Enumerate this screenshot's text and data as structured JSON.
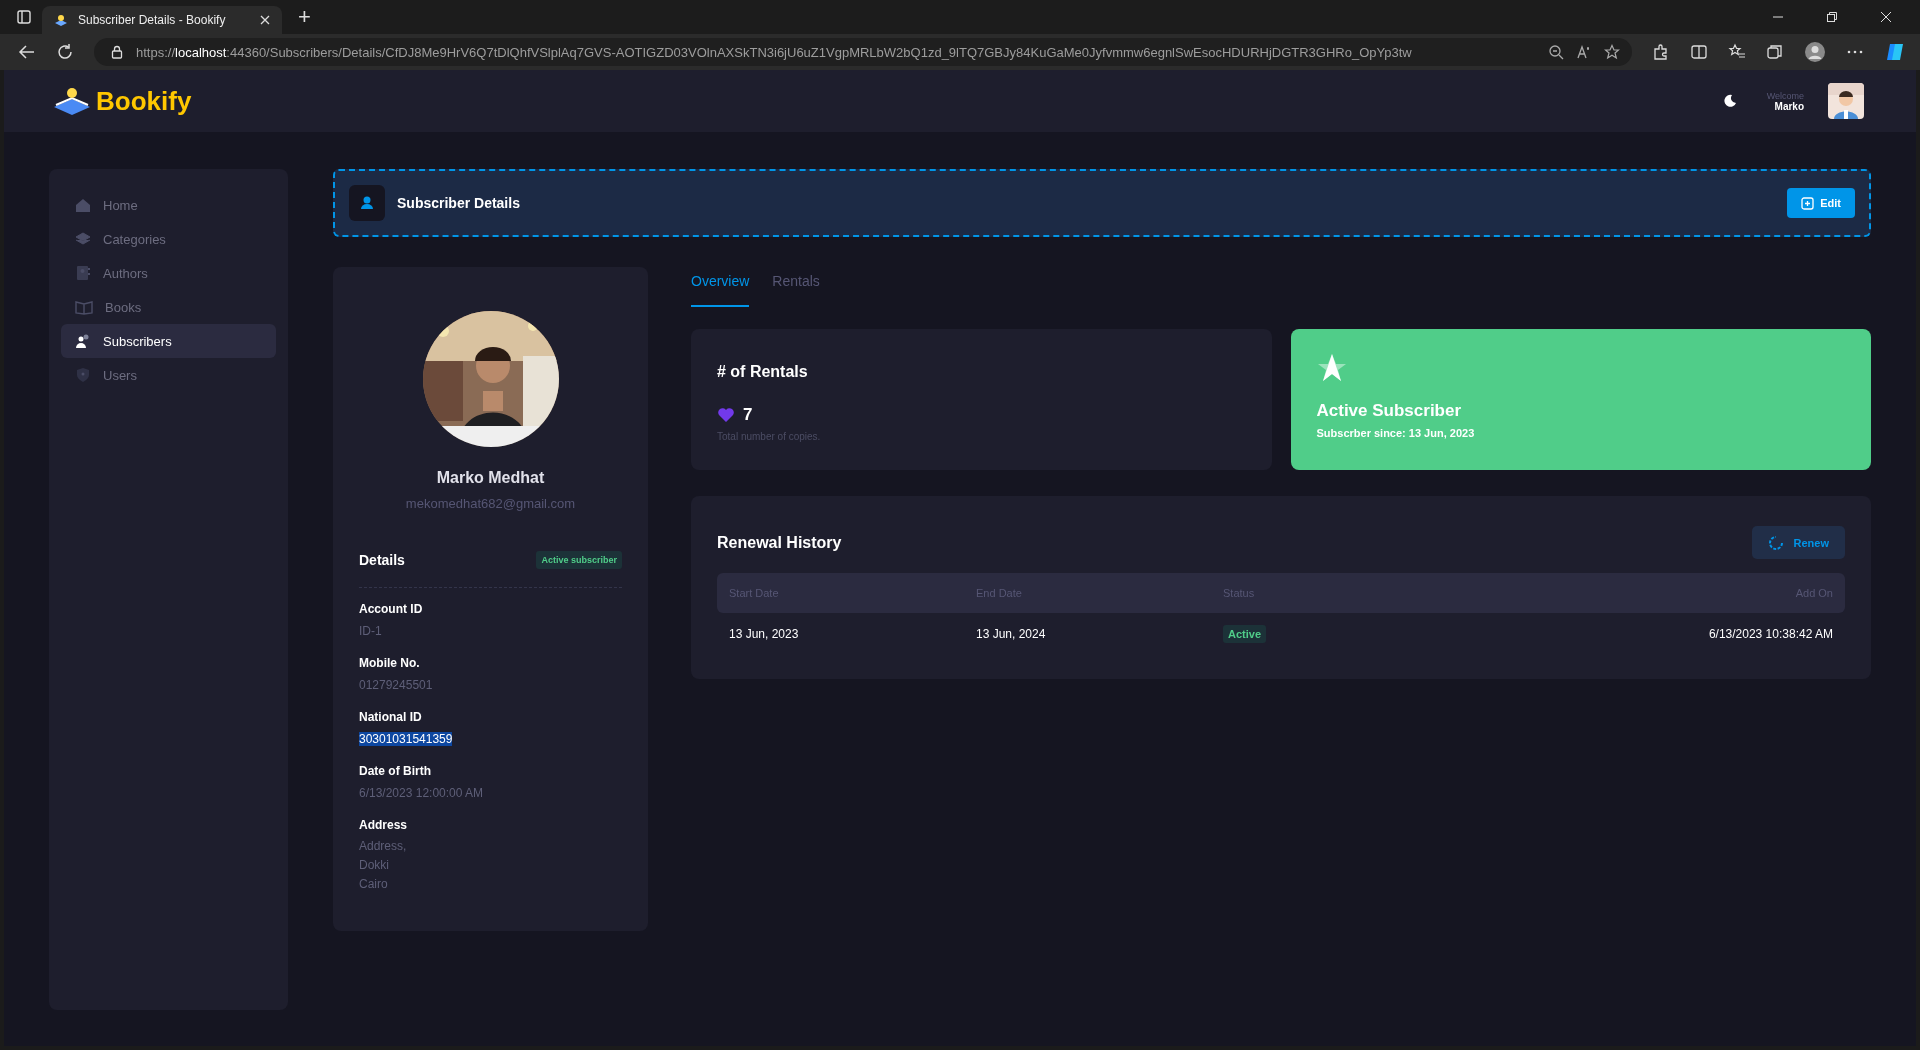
{
  "browser": {
    "tab_title": "Subscriber Details - Bookify",
    "new_tab": "+",
    "url": "https://**localhost**:44360/Subscribers/Details/CfDJ8Me9HrV6Q7tDlQhfVSlplAq7GVS-AOTIGZD03VOlnAXSkTN3i6jU6uZ1VgpMRLbW2bQ1zd_9lTQ7GBJy84KuGaMe0Jyfvmmw6egnlSwEsocHDURHjDGTR3GHRo_OpYp3tw"
  },
  "header": {
    "logo": "Bookify",
    "welcome": "Welcome",
    "user": "Marko"
  },
  "sidebar": {
    "items": [
      {
        "label": "Home",
        "kind": "home",
        "selected": false
      },
      {
        "label": "Categories",
        "kind": "layers",
        "selected": false
      },
      {
        "label": "Authors",
        "kind": "contacts",
        "selected": false
      },
      {
        "label": "Books",
        "kind": "book",
        "selected": false
      },
      {
        "label": "Subscribers",
        "kind": "people",
        "selected": true
      },
      {
        "label": "Users",
        "kind": "shield",
        "selected": false
      }
    ]
  },
  "page_title": "Subscriber Details",
  "edit_button": "Edit",
  "profile": {
    "name": "Marko Medhat",
    "email": "mekomedhat682@gmail.com",
    "details_title": "Details",
    "badge": "Active subscriber",
    "fields": [
      {
        "label": "Account ID",
        "lines": [
          "ID-1"
        ],
        "highlighted": false
      },
      {
        "label": "Mobile No.",
        "lines": [
          "01279245501"
        ],
        "highlighted": false
      },
      {
        "label": "National ID",
        "lines": [
          "30301031541359"
        ],
        "highlighted": true
      },
      {
        "label": "Date of Birth",
        "lines": [
          "6/13/2023 12:00:00 AM"
        ],
        "highlighted": false
      },
      {
        "label": "Address",
        "lines": [
          "Address,",
          "Dokki",
          "Cairo"
        ],
        "highlighted": false
      }
    ]
  },
  "tabs": [
    {
      "label": "Overview",
      "selected": true
    },
    {
      "label": "Rentals",
      "selected": false
    }
  ],
  "rentals_card": {
    "title": "# of Rentals",
    "count": "7",
    "note": "Total number of copies."
  },
  "status_card": {
    "title": "Active Subscriber",
    "since": "Subscrber since: 13 Jun, 2023"
  },
  "renewal": {
    "title": "Renewal History",
    "button": "Renew",
    "columns": [
      "Start Date",
      "End Date",
      "Status",
      "Add On"
    ],
    "rows": [
      {
        "start": "13 Jun, 2023",
        "end": "13 Jun, 2024",
        "status": "Active",
        "color": "#50cd89",
        "added": "6/13/2023 10:38:42 AM"
      }
    ]
  }
}
